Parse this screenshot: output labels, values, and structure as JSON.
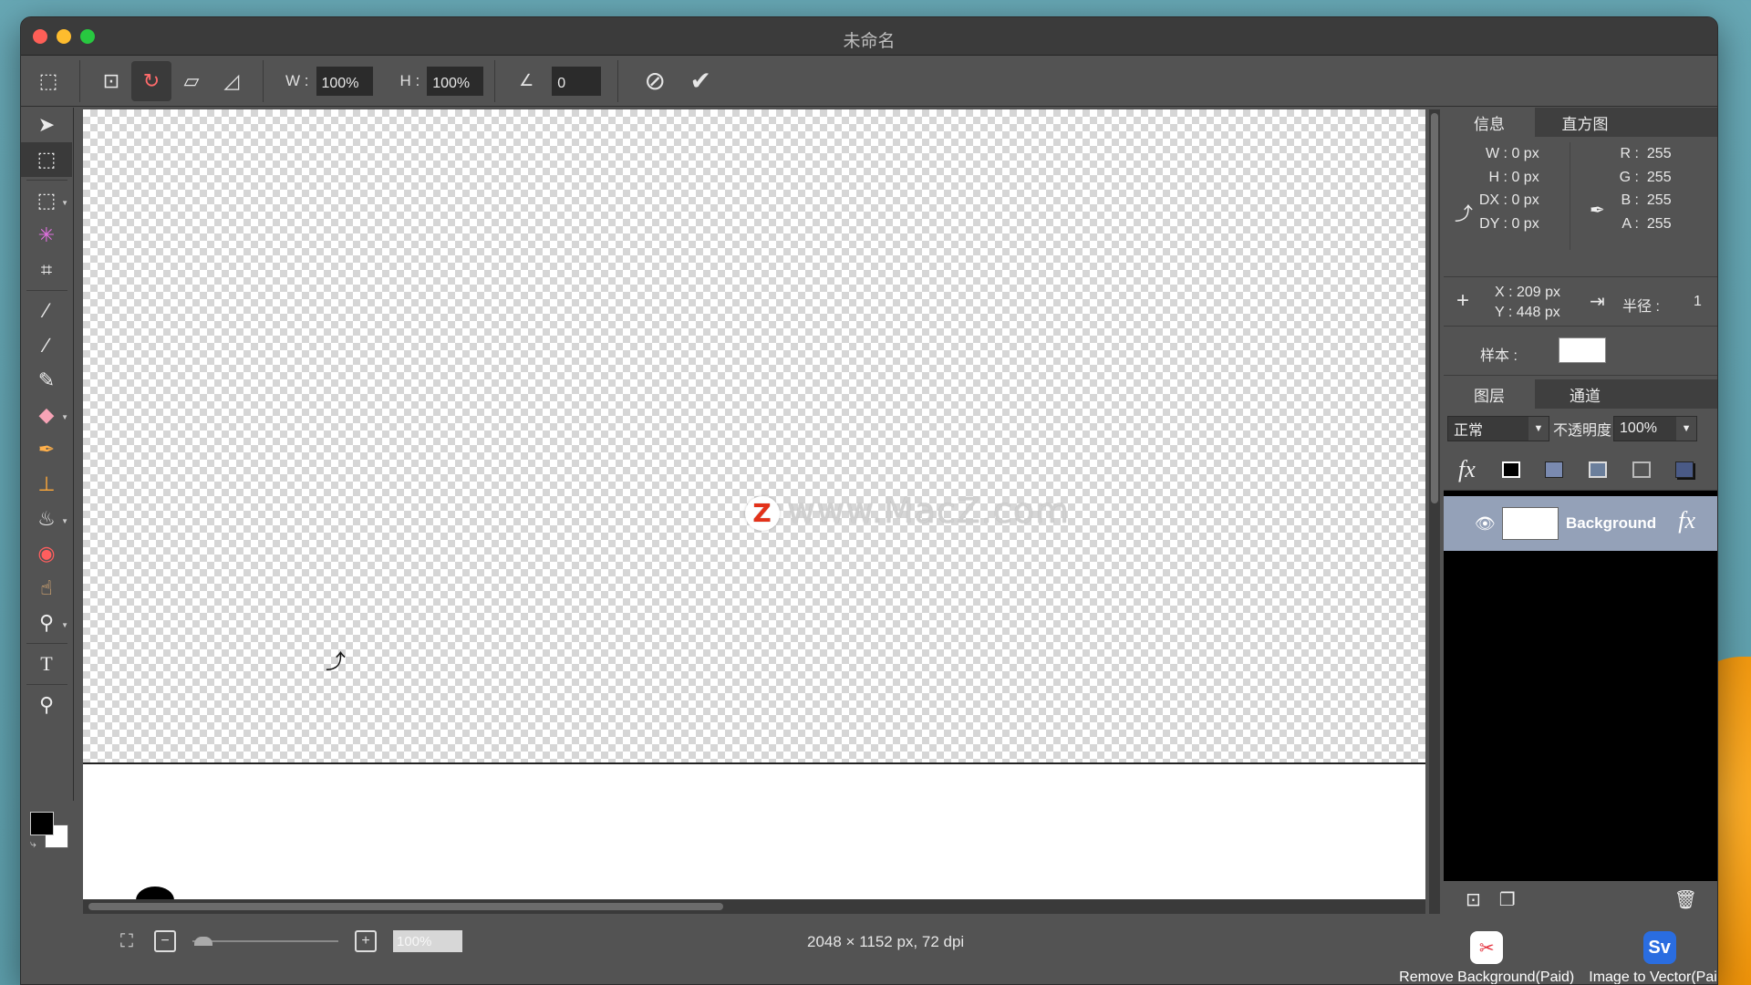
{
  "window": {
    "title": "未命名"
  },
  "options_bar": {
    "w_label": "W :",
    "w_value": "100%",
    "h_label": "H :",
    "h_value": "100%",
    "angle_value": "0"
  },
  "canvas": {
    "watermark_logo": "Z",
    "watermark_text": "www.MacZ.com"
  },
  "status": {
    "zoom_value": "100%",
    "dimensions": "2048 × 1152 px, 72 dpi"
  },
  "info_panel": {
    "tabs": [
      "信息",
      "直方图"
    ],
    "size": [
      {
        "label": "W :",
        "value": "0 px"
      },
      {
        "label": "H :",
        "value": "0 px"
      },
      {
        "label": "DX :",
        "value": "0 px"
      },
      {
        "label": "DY :",
        "value": "0 px"
      }
    ],
    "color": [
      {
        "label": "R :",
        "value": "255"
      },
      {
        "label": "G :",
        "value": "255"
      },
      {
        "label": "B :",
        "value": "255"
      },
      {
        "label": "A :",
        "value": "255"
      }
    ],
    "x": "X :  209 px",
    "y": "Y :  448 px",
    "radius_label": "半径 :",
    "radius_value": "1",
    "sample_label": "样本 :"
  },
  "layers_panel": {
    "tabs": [
      "图层",
      "通道"
    ],
    "blend_mode": "正常",
    "opacity_label": "不透明度",
    "opacity_value": "100%",
    "fx_label": "fx",
    "layers": [
      {
        "name": "Background"
      }
    ]
  },
  "plugins": [
    {
      "label": "Remove Background(Paid)",
      "icon": "scissors-icon"
    },
    {
      "label": "Image to Vector(Paid)",
      "icon": "Sv"
    }
  ]
}
